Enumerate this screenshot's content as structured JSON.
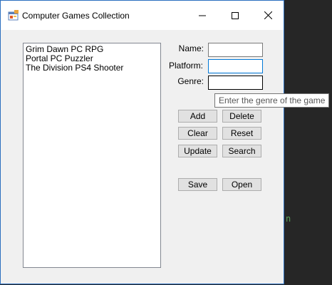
{
  "window": {
    "title": "Computer Games Collection",
    "icon": "app-forms-icon"
  },
  "titlebar_buttons": {
    "minimize": "minimize-icon",
    "maximize": "maximize-icon",
    "close": "close-icon"
  },
  "games_list": {
    "items": [
      "Grim Dawn PC RPG",
      "Portal PC Puzzler",
      "The Division PS4 Shooter"
    ]
  },
  "form": {
    "name_label": "Name:",
    "name_value": "",
    "platform_label": "Platform:",
    "platform_value": "",
    "genre_label": "Genre:",
    "genre_value": ""
  },
  "tooltip": {
    "text": "Enter the genre of the game"
  },
  "buttons": {
    "add": "Add",
    "delete": "Delete",
    "clear": "Clear",
    "reset": "Reset",
    "update": "Update",
    "search": "Search",
    "save": "Save",
    "open": "Open"
  },
  "background": {
    "editor_fragment": "n"
  },
  "colors": {
    "window_bg": "#f0f0f0",
    "focus_border": "#0078d7",
    "button_bg": "#e1e1e1"
  }
}
